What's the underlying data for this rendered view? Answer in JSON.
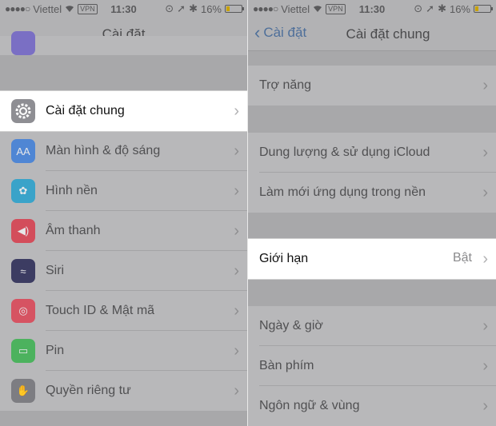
{
  "status_bar": {
    "signal": "●●●●○",
    "carrier": "Viettel",
    "wifi": "wifi-icon",
    "vpn": "VPN",
    "time": "11:30",
    "battery": "16%",
    "battery_level": 0.16
  },
  "left": {
    "title": "Cài đặt",
    "items": [
      {
        "label": "Cài đặt chung",
        "icon": "gear-icon",
        "color": "#8e8e93",
        "highlighted": true
      },
      {
        "label": "Màn hình & độ sáng",
        "icon": "text-size-icon",
        "color": "#4f86d4"
      },
      {
        "label": "Hình nền",
        "icon": "flower-icon",
        "color": "#3aa3c9"
      },
      {
        "label": "Âm thanh",
        "icon": "speaker-icon",
        "color": "#d34d5b"
      },
      {
        "label": "Siri",
        "icon": "siri-icon",
        "color": "#3c3c62"
      },
      {
        "label": "Touch ID & Mật mã",
        "icon": "fingerprint-icon",
        "color": "#d65362"
      },
      {
        "label": "Pin",
        "icon": "battery-icon",
        "color": "#4cb25e"
      },
      {
        "label": "Quyền riêng tư",
        "icon": "hand-icon",
        "color": "#7d7d82"
      }
    ]
  },
  "right": {
    "back_label": "Cài đặt",
    "title": "Cài đặt chung",
    "items": [
      {
        "label": "Trợ năng"
      },
      {
        "label": "Dung lượng & sử dụng iCloud"
      },
      {
        "label": "Làm mới ứng dụng trong nền"
      },
      {
        "label": "Giới hạn",
        "value": "Bật",
        "highlighted": true
      },
      {
        "label": "Ngày & giờ"
      },
      {
        "label": "Bàn phím"
      },
      {
        "label": "Ngôn ngữ & vùng"
      }
    ]
  }
}
